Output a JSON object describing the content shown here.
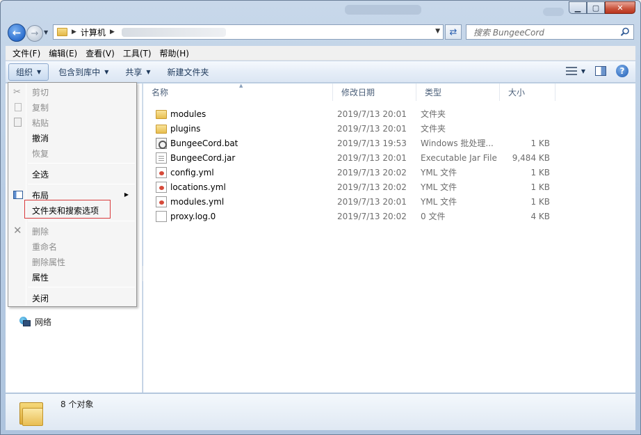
{
  "window": {
    "caption_buttons": {
      "minimize": "▁",
      "maximize": "▢",
      "close": "✕"
    }
  },
  "address_bar": {
    "crumbs": [
      "计算机"
    ]
  },
  "search": {
    "placeholder": "搜索 BungeeCord"
  },
  "menubar": [
    "文件(F)",
    "编辑(E)",
    "查看(V)",
    "工具(T)",
    "帮助(H)"
  ],
  "commandbar": {
    "organize": "组织",
    "include_library": "包含到库中",
    "share": "共享",
    "new_folder": "新建文件夹"
  },
  "columns": {
    "name": "名称",
    "date": "修改日期",
    "type": "类型",
    "size": "大小"
  },
  "files": [
    {
      "name": "modules",
      "date": "2019/7/13 20:01",
      "type": "文件夹",
      "size": "",
      "icon": "folder-icon"
    },
    {
      "name": "plugins",
      "date": "2019/7/13 20:01",
      "type": "文件夹",
      "size": "",
      "icon": "folder-icon"
    },
    {
      "name": "BungeeCord.bat",
      "date": "2019/7/13 19:53",
      "type": "Windows 批处理...",
      "size": "1 KB",
      "icon": "batch-file-icon"
    },
    {
      "name": "BungeeCord.jar",
      "date": "2019/7/13 20:01",
      "type": "Executable Jar File",
      "size": "9,484 KB",
      "icon": "jar-file-icon"
    },
    {
      "name": "config.yml",
      "date": "2019/7/13 20:02",
      "type": "YML 文件",
      "size": "1 KB",
      "icon": "yml-file-icon"
    },
    {
      "name": "locations.yml",
      "date": "2019/7/13 20:02",
      "type": "YML 文件",
      "size": "1 KB",
      "icon": "yml-file-icon"
    },
    {
      "name": "modules.yml",
      "date": "2019/7/13 20:01",
      "type": "YML 文件",
      "size": "1 KB",
      "icon": "yml-file-icon"
    },
    {
      "name": "proxy.log.0",
      "date": "2019/7/13 20:02",
      "type": "0 文件",
      "size": "4 KB",
      "icon": "text-file-icon"
    }
  ],
  "navpane": {
    "network": "网络"
  },
  "context_menu": {
    "cut": "剪切",
    "copy": "复制",
    "paste": "粘贴",
    "undo": "撤消",
    "redo": "恢复",
    "select_all": "全选",
    "layout": "布局",
    "folder_options": "文件夹和搜索选项",
    "delete": "删除",
    "rename": "重命名",
    "remove_properties": "删除属性",
    "properties": "属性",
    "close": "关闭"
  },
  "status": {
    "item_count": "8 个对象"
  }
}
